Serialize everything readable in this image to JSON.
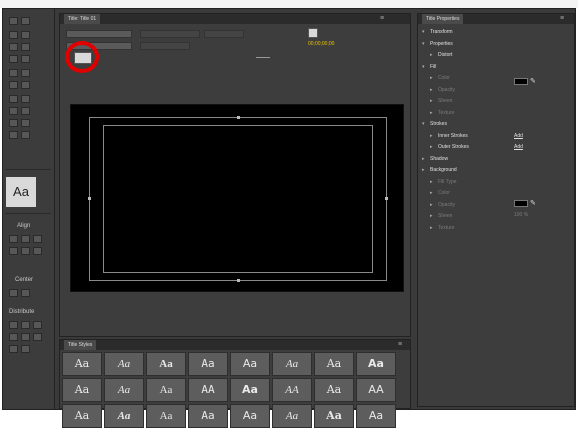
{
  "window": {
    "titlebar_text": ""
  },
  "title_panel": {
    "tab_label": "Title: Title 01",
    "tab_index": "",
    "menu_icon": "panel-menu-icon",
    "timecode": "00;00;00;00"
  },
  "tools_panel": {
    "text_swatch_label": "Aa",
    "align_label": "Align",
    "center_label": "Center",
    "distribute_label": "Distribute"
  },
  "properties": {
    "tab_label": "Title Properties",
    "rows": [
      {
        "label": "Transform",
        "level": 0,
        "open": true
      },
      {
        "label": "Properties",
        "level": 0,
        "open": true
      },
      {
        "label": "Distort",
        "level": 1,
        "open": false
      },
      {
        "label": "Fill",
        "level": 0,
        "open": true
      },
      {
        "label": "Color",
        "level": 1,
        "dim": true
      },
      {
        "label": "Opacity",
        "level": 1,
        "dim": true
      },
      {
        "label": "Sheen",
        "level": 1,
        "dim": true
      },
      {
        "label": "Texture",
        "level": 1,
        "dim": true
      },
      {
        "label": "Strokes",
        "level": 0,
        "open": true
      },
      {
        "label": "Inner Strokes",
        "level": 1,
        "action": "Add"
      },
      {
        "label": "Outer Strokes",
        "level": 1,
        "action": "Add"
      },
      {
        "label": "Shadow",
        "level": 0,
        "open": false
      },
      {
        "label": "Background",
        "level": 0,
        "open": false
      },
      {
        "label": "Fill Type",
        "level": 1,
        "dim": true
      },
      {
        "label": "Color",
        "level": 1,
        "dim": true
      },
      {
        "label": "Opacity",
        "level": 1,
        "dim": true
      },
      {
        "label": "Sheen",
        "level": 1,
        "dim": true
      },
      {
        "label": "Texture",
        "level": 1,
        "dim": true
      }
    ],
    "opacity_value": "100 %"
  },
  "styles": {
    "tab_label": "Title Styles",
    "cells": [
      "Aa",
      "Aa",
      "Aa",
      "Aa",
      "Aa",
      "Aa",
      "Aa",
      "Aa",
      "Aa",
      "Aa",
      "Aa",
      "AA",
      "Aa",
      "AA",
      "Aa",
      "AA",
      "Aa",
      "Aa",
      "Aa",
      "Aa",
      "Aa",
      "Aa",
      "Aa",
      "Aa"
    ]
  },
  "colors": {
    "highlight_ring": "#e00000",
    "timecode": "#e8c300"
  }
}
